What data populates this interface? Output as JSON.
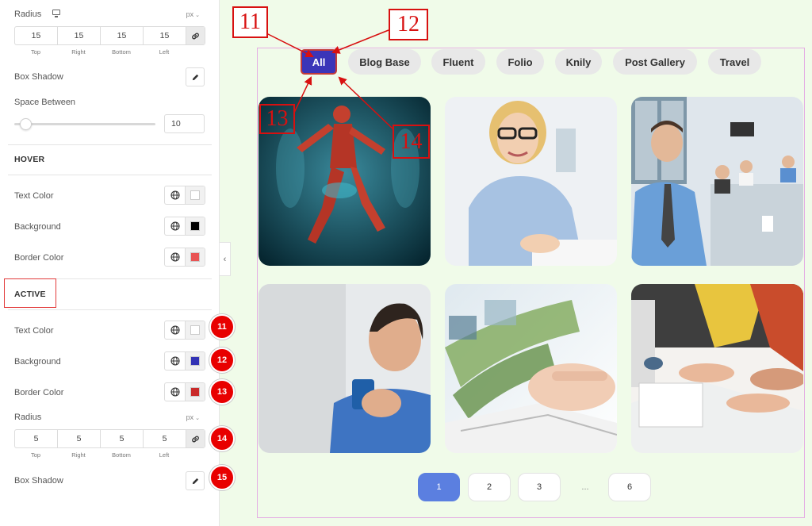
{
  "panel": {
    "radius_top": {
      "label": "Radius",
      "unit": "px",
      "values": [
        "15",
        "15",
        "15",
        "15"
      ],
      "captions": [
        "Top",
        "Right",
        "Bottom",
        "Left"
      ]
    },
    "box_shadow_label": "Box Shadow",
    "space_between": {
      "label": "Space Between",
      "value": "10",
      "slider_level": 0.08
    },
    "hover": {
      "title": "HOVER",
      "rows": [
        {
          "label": "Text Color",
          "color": "#ffffff"
        },
        {
          "label": "Background",
          "color": "#000000"
        },
        {
          "label": "Border Color",
          "color": "#e85454"
        }
      ]
    },
    "active": {
      "title": "ACTIVE",
      "rows": [
        {
          "label": "Text Color",
          "color": "#ffffff",
          "badge": "11"
        },
        {
          "label": "Background",
          "color": "#3333b5",
          "badge": "12"
        },
        {
          "label": "Border Color",
          "color": "#c92a2a",
          "badge": "13"
        }
      ],
      "radius": {
        "label": "Radius",
        "unit": "px",
        "values": [
          "5",
          "5",
          "5",
          "5"
        ],
        "captions": [
          "Top",
          "Right",
          "Bottom",
          "Left"
        ],
        "badge": "14"
      },
      "box_shadow": {
        "label": "Box Shadow",
        "badge": "15"
      }
    }
  },
  "filters": [
    {
      "label": "All",
      "active": true
    },
    {
      "label": "Blog Base",
      "active": false
    },
    {
      "label": "Fluent",
      "active": false
    },
    {
      "label": "Folio",
      "active": false
    },
    {
      "label": "Knily",
      "active": false
    },
    {
      "label": "Post Gallery",
      "active": false
    },
    {
      "label": "Travel",
      "active": false
    }
  ],
  "pagination": [
    "1",
    "2",
    "3",
    "...",
    "6"
  ],
  "annotations": [
    "11",
    "12",
    "13",
    "14"
  ],
  "colors": {
    "accent": "#3b35b8",
    "annotation": "#d81010",
    "page_active": "#5b7fe0"
  }
}
